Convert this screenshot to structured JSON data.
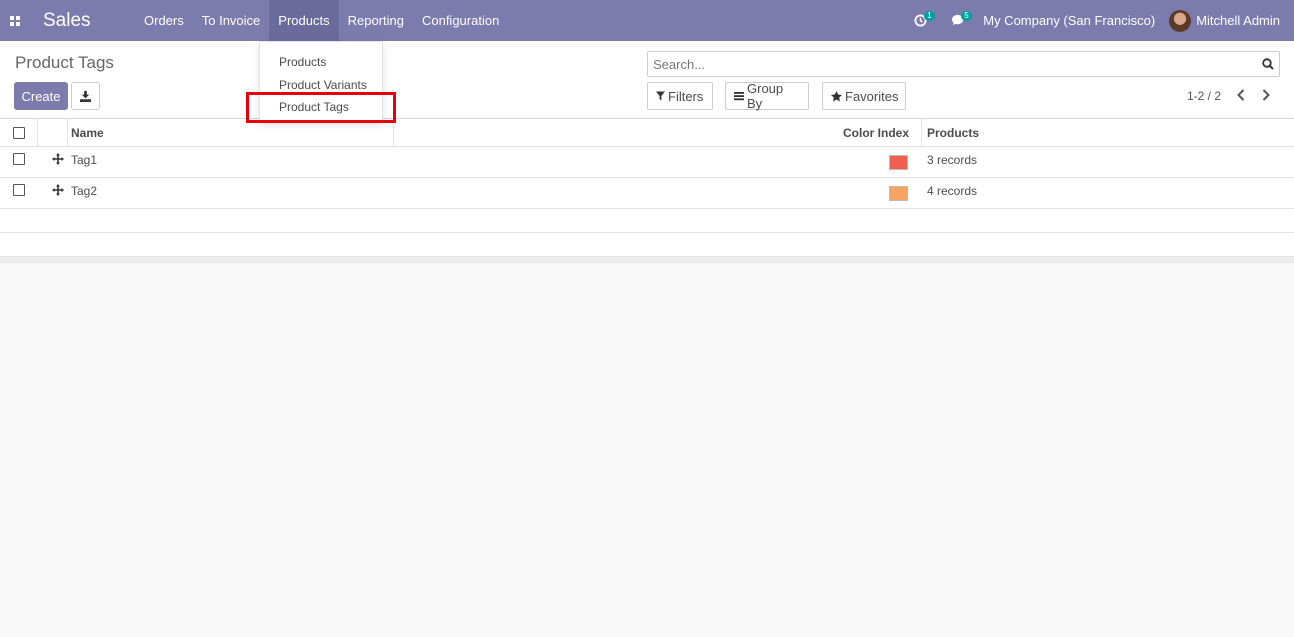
{
  "navbar": {
    "app_name": "Sales",
    "menu": [
      "Orders",
      "To Invoice",
      "Products",
      "Reporting",
      "Configuration"
    ],
    "activity_count": "1",
    "messages_count": "5",
    "company": "My Company (San Francisco)",
    "user": "Mitchell Admin",
    "color": "#7c7bad"
  },
  "dropdown": {
    "items": [
      "Products",
      "Product Variants",
      "Product Tags"
    ],
    "highlighted": "Product Tags"
  },
  "control_panel": {
    "title": "Product Tags",
    "create_label": "Create",
    "search_placeholder": "Search...",
    "filters_label": "Filters",
    "group_by_label": "Group By",
    "favorites_label": "Favorites",
    "pager": "1-2 / 2"
  },
  "table": {
    "columns": [
      "Name",
      "Color Index",
      "Products"
    ],
    "rows": [
      {
        "name": "Tag1",
        "color": "#f06050",
        "products": "3 records"
      },
      {
        "name": "Tag2",
        "color": "#f4a460",
        "products": "4 records"
      }
    ]
  }
}
